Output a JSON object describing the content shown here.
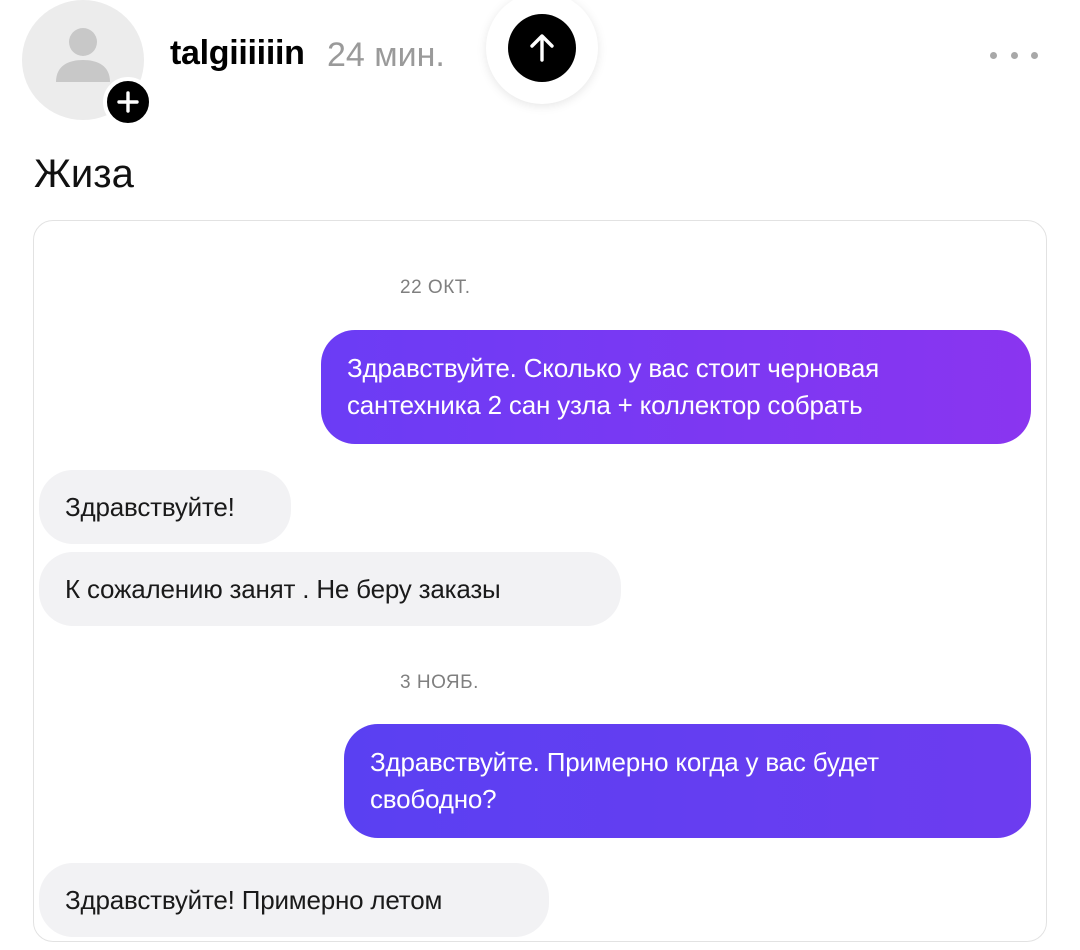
{
  "post": {
    "username": "talgiiiiiin",
    "time_ago": "24 мин.",
    "text": "Жиза",
    "avatar_icon": "user-icon",
    "follow_icon": "plus-icon",
    "scroll_icon": "arrow-up-icon",
    "more_icon": "ellipsis-icon"
  },
  "chat": {
    "messages": [
      {
        "type": "date",
        "text": "22 ОКТ."
      },
      {
        "type": "outgoing",
        "text": "Здравствуйте. Сколько у вас стоит черновая сантехника 2 сан узла + коллектор собрать"
      },
      {
        "type": "incoming",
        "text": "Здравствуйте!"
      },
      {
        "type": "incoming",
        "text": "К сожалению занят . Не беру заказы"
      },
      {
        "type": "date",
        "text": "3 НОЯБ."
      },
      {
        "type": "outgoing",
        "text": "Здравствуйте. Примерно когда у вас будет свободно?"
      },
      {
        "type": "incoming",
        "text": "Здравствуйте! Примерно летом"
      }
    ]
  },
  "colors": {
    "outgoing_bubble_1": [
      "#6b3cf5",
      "#8a35f0"
    ],
    "outgoing_bubble_2": [
      "#5a40f2",
      "#6d3cf0"
    ],
    "incoming_bubble": "#f2f2f4",
    "muted_text": "#9a9a9a"
  }
}
